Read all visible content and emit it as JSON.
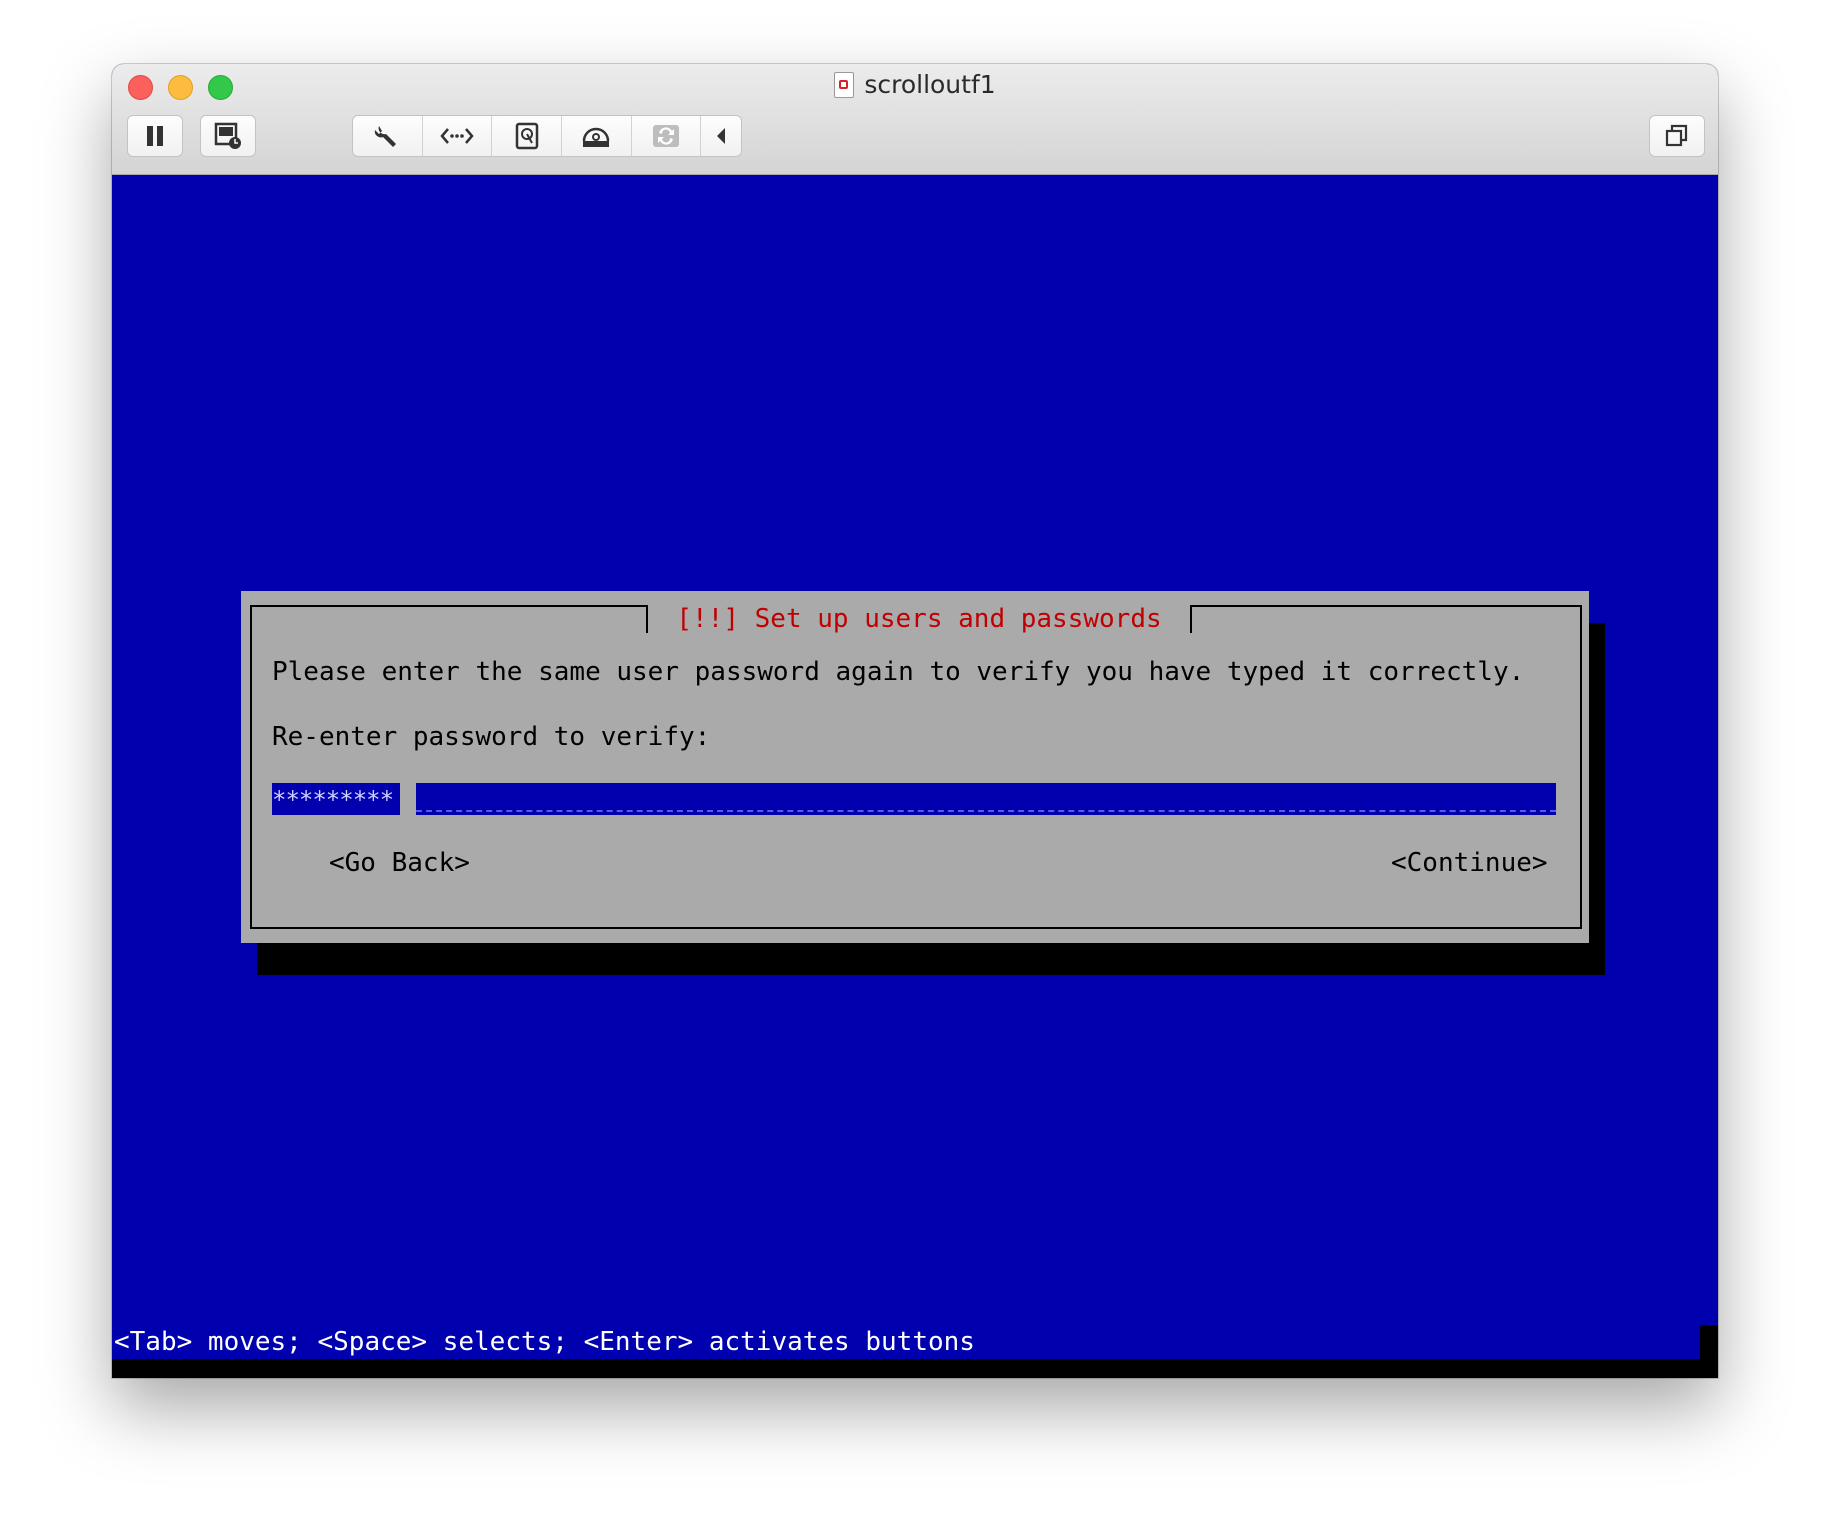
{
  "window": {
    "title": "scrolloutf1"
  },
  "toolbar": {
    "pause_icon": "pause-icon",
    "snapshot_icon": "snapshot-icon",
    "settings_icon": "wrench-icon",
    "network_icon": "network-icon",
    "disk_icon": "hard-disk-icon",
    "cd_icon": "optical-drive-icon",
    "usb_icon": "usb-sync-icon",
    "collapse_icon": "chevron-left-icon",
    "restore_icon": "restore-window-icon"
  },
  "dialog": {
    "title": " [!!] Set up users and passwords ",
    "prompt": "Please enter the same user password again to verify you have typed it correctly.",
    "label": "Re-enter password to verify:",
    "password_mask": "*********",
    "go_back": "<Go Back>",
    "continue": "<Continue>"
  },
  "status": {
    "help": "<Tab> moves; <Space> selects; <Enter> activates buttons"
  },
  "colors": {
    "screen_bg": "#0000ae",
    "dialog_bg": "#aaaaaa",
    "title_red": "#c00000"
  }
}
